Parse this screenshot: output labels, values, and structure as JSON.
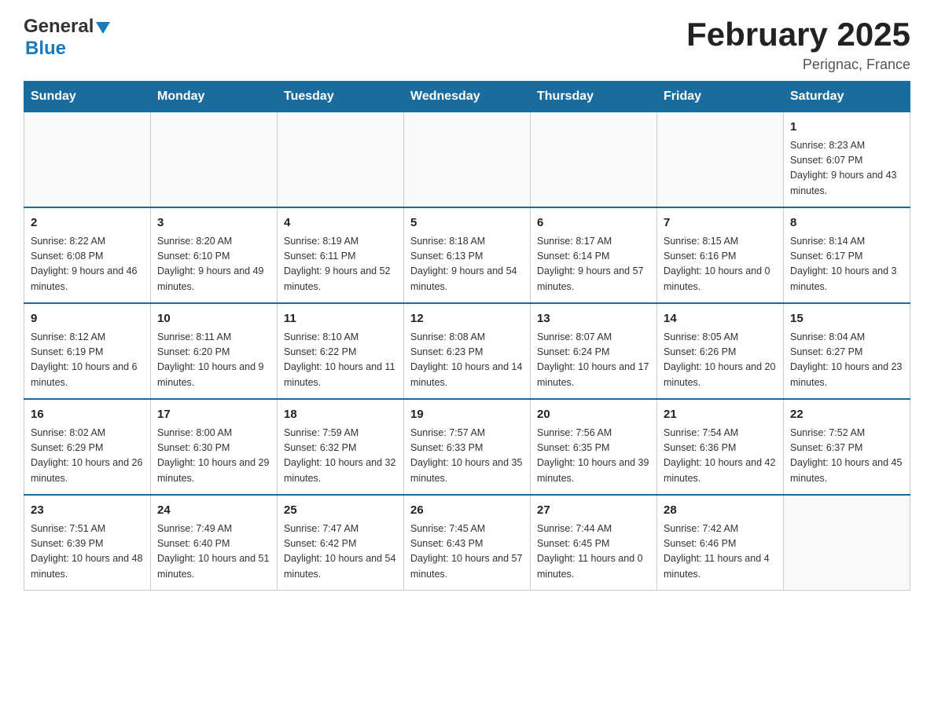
{
  "header": {
    "logo_general": "General",
    "logo_blue": "Blue",
    "title": "February 2025",
    "location": "Perignac, France"
  },
  "weekdays": [
    "Sunday",
    "Monday",
    "Tuesday",
    "Wednesday",
    "Thursday",
    "Friday",
    "Saturday"
  ],
  "weeks": [
    [
      {
        "day": "",
        "info": ""
      },
      {
        "day": "",
        "info": ""
      },
      {
        "day": "",
        "info": ""
      },
      {
        "day": "",
        "info": ""
      },
      {
        "day": "",
        "info": ""
      },
      {
        "day": "",
        "info": ""
      },
      {
        "day": "1",
        "info": "Sunrise: 8:23 AM\nSunset: 6:07 PM\nDaylight: 9 hours and 43 minutes."
      }
    ],
    [
      {
        "day": "2",
        "info": "Sunrise: 8:22 AM\nSunset: 6:08 PM\nDaylight: 9 hours and 46 minutes."
      },
      {
        "day": "3",
        "info": "Sunrise: 8:20 AM\nSunset: 6:10 PM\nDaylight: 9 hours and 49 minutes."
      },
      {
        "day": "4",
        "info": "Sunrise: 8:19 AM\nSunset: 6:11 PM\nDaylight: 9 hours and 52 minutes."
      },
      {
        "day": "5",
        "info": "Sunrise: 8:18 AM\nSunset: 6:13 PM\nDaylight: 9 hours and 54 minutes."
      },
      {
        "day": "6",
        "info": "Sunrise: 8:17 AM\nSunset: 6:14 PM\nDaylight: 9 hours and 57 minutes."
      },
      {
        "day": "7",
        "info": "Sunrise: 8:15 AM\nSunset: 6:16 PM\nDaylight: 10 hours and 0 minutes."
      },
      {
        "day": "8",
        "info": "Sunrise: 8:14 AM\nSunset: 6:17 PM\nDaylight: 10 hours and 3 minutes."
      }
    ],
    [
      {
        "day": "9",
        "info": "Sunrise: 8:12 AM\nSunset: 6:19 PM\nDaylight: 10 hours and 6 minutes."
      },
      {
        "day": "10",
        "info": "Sunrise: 8:11 AM\nSunset: 6:20 PM\nDaylight: 10 hours and 9 minutes."
      },
      {
        "day": "11",
        "info": "Sunrise: 8:10 AM\nSunset: 6:22 PM\nDaylight: 10 hours and 11 minutes."
      },
      {
        "day": "12",
        "info": "Sunrise: 8:08 AM\nSunset: 6:23 PM\nDaylight: 10 hours and 14 minutes."
      },
      {
        "day": "13",
        "info": "Sunrise: 8:07 AM\nSunset: 6:24 PM\nDaylight: 10 hours and 17 minutes."
      },
      {
        "day": "14",
        "info": "Sunrise: 8:05 AM\nSunset: 6:26 PM\nDaylight: 10 hours and 20 minutes."
      },
      {
        "day": "15",
        "info": "Sunrise: 8:04 AM\nSunset: 6:27 PM\nDaylight: 10 hours and 23 minutes."
      }
    ],
    [
      {
        "day": "16",
        "info": "Sunrise: 8:02 AM\nSunset: 6:29 PM\nDaylight: 10 hours and 26 minutes."
      },
      {
        "day": "17",
        "info": "Sunrise: 8:00 AM\nSunset: 6:30 PM\nDaylight: 10 hours and 29 minutes."
      },
      {
        "day": "18",
        "info": "Sunrise: 7:59 AM\nSunset: 6:32 PM\nDaylight: 10 hours and 32 minutes."
      },
      {
        "day": "19",
        "info": "Sunrise: 7:57 AM\nSunset: 6:33 PM\nDaylight: 10 hours and 35 minutes."
      },
      {
        "day": "20",
        "info": "Sunrise: 7:56 AM\nSunset: 6:35 PM\nDaylight: 10 hours and 39 minutes."
      },
      {
        "day": "21",
        "info": "Sunrise: 7:54 AM\nSunset: 6:36 PM\nDaylight: 10 hours and 42 minutes."
      },
      {
        "day": "22",
        "info": "Sunrise: 7:52 AM\nSunset: 6:37 PM\nDaylight: 10 hours and 45 minutes."
      }
    ],
    [
      {
        "day": "23",
        "info": "Sunrise: 7:51 AM\nSunset: 6:39 PM\nDaylight: 10 hours and 48 minutes."
      },
      {
        "day": "24",
        "info": "Sunrise: 7:49 AM\nSunset: 6:40 PM\nDaylight: 10 hours and 51 minutes."
      },
      {
        "day": "25",
        "info": "Sunrise: 7:47 AM\nSunset: 6:42 PM\nDaylight: 10 hours and 54 minutes."
      },
      {
        "day": "26",
        "info": "Sunrise: 7:45 AM\nSunset: 6:43 PM\nDaylight: 10 hours and 57 minutes."
      },
      {
        "day": "27",
        "info": "Sunrise: 7:44 AM\nSunset: 6:45 PM\nDaylight: 11 hours and 0 minutes."
      },
      {
        "day": "28",
        "info": "Sunrise: 7:42 AM\nSunset: 6:46 PM\nDaylight: 11 hours and 4 minutes."
      },
      {
        "day": "",
        "info": ""
      }
    ]
  ]
}
